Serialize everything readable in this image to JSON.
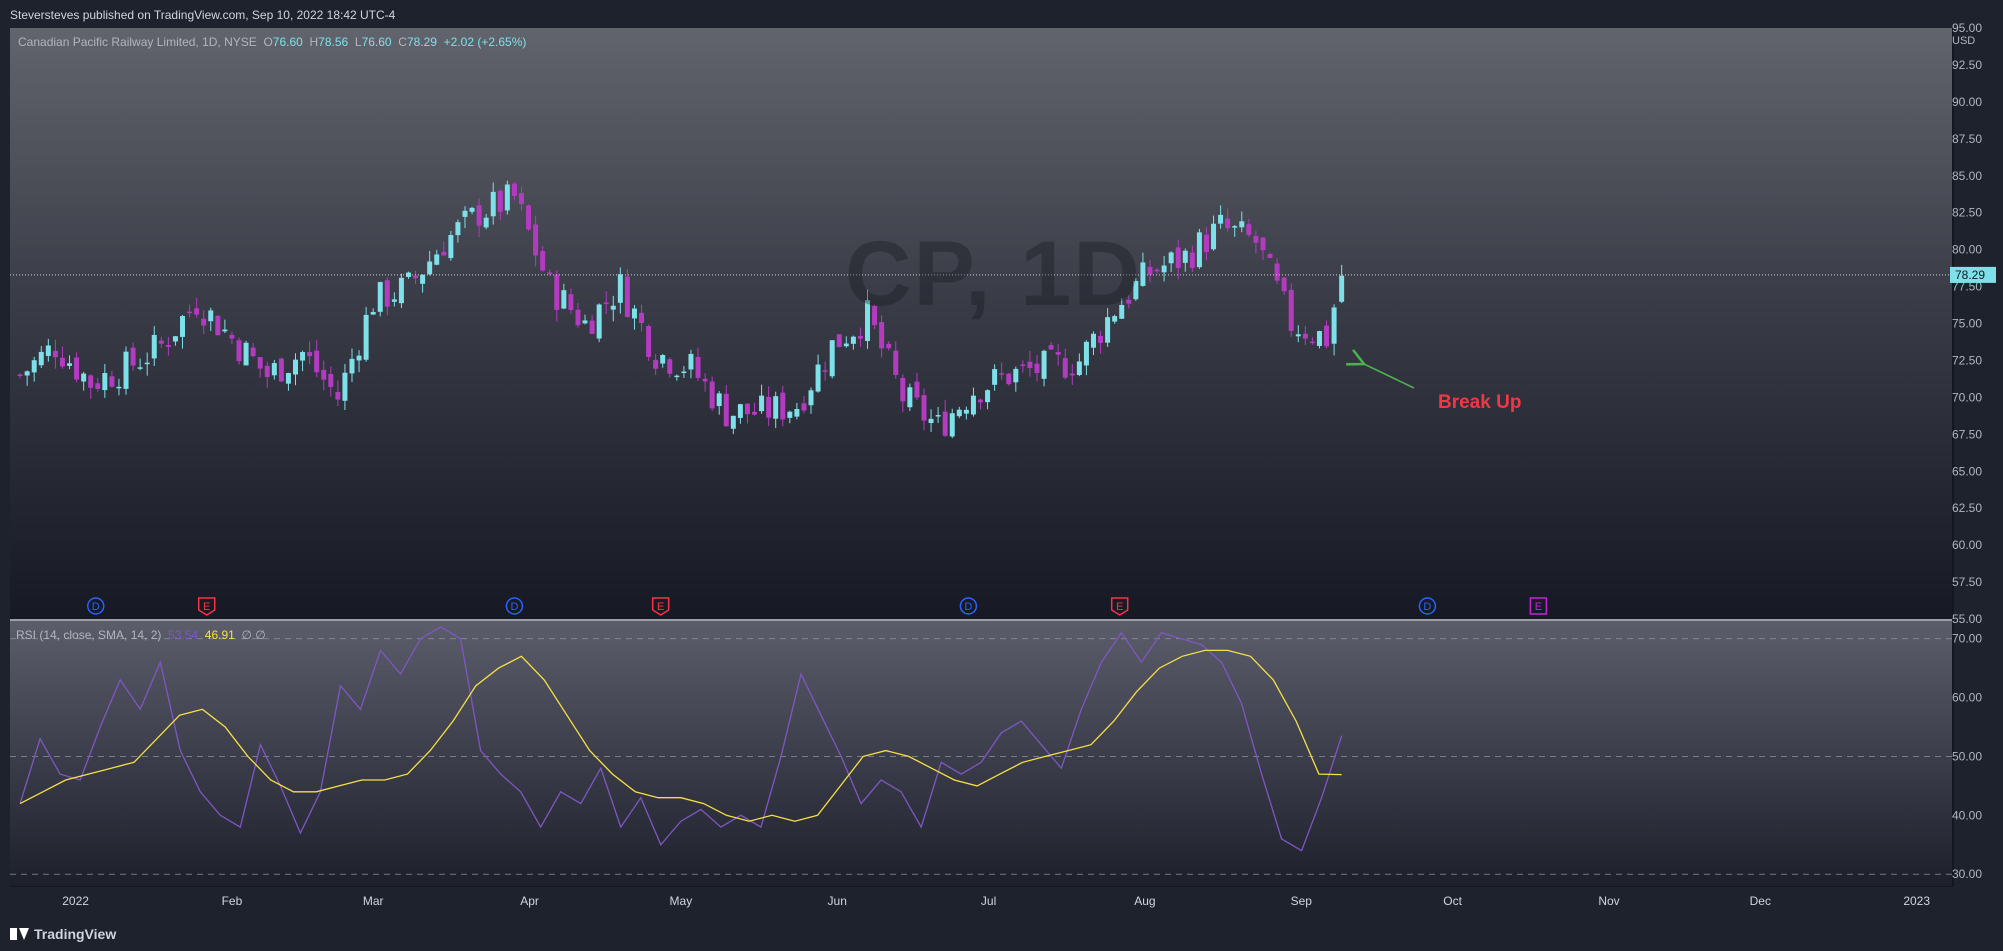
{
  "header": {
    "published": "Steversteves published on TradingView.com, Sep 10, 2022 18:42 UTC-4"
  },
  "legend": {
    "symbol": "Canadian Pacific Railway Limited, 1D, NYSE",
    "open_label": "O",
    "open": "76.60",
    "high_label": "H",
    "high": "78.56",
    "low_label": "L",
    "low": "76.60",
    "close_label": "C",
    "close": "78.29",
    "change": "+2.02 (+2.65%)"
  },
  "watermark": "CP, 1D",
  "annotation": "Break Up",
  "rsi_legend": {
    "label": "RSI (14, close, SMA, 14, 2)",
    "value_rsi": "53.54",
    "value_sma": "46.91",
    "extra": "∅ ∅"
  },
  "branding": "TradingView",
  "colors": {
    "up": "#7ee0e8",
    "down": "#b23bc0",
    "rsi_line": "#7e57c2",
    "rsi_sma": "#f6e043",
    "annotation": "#f23645",
    "arrow": "#4caf50"
  },
  "chart_data": [
    {
      "type": "candlestick",
      "currency": "USD",
      "ylim": [
        55.0,
        95.0
      ],
      "y_ticks": [
        "95.00",
        "92.50",
        "90.00",
        "87.50",
        "85.00",
        "82.50",
        "80.00",
        "77.50",
        "75.00",
        "72.50",
        "70.00",
        "67.50",
        "65.00",
        "62.50",
        "60.00",
        "57.50",
        "55.00"
      ],
      "last_price": 78.29,
      "last_price_label": "78.29",
      "x_ticks": [
        "2022",
        "Feb",
        "Mar",
        "Apr",
        "May",
        "Jun",
        "Jul",
        "Aug",
        "Sep",
        "Oct",
        "Nov",
        "Dec",
        "2023"
      ],
      "events": [
        {
          "date": "2022-01-05",
          "type": "D",
          "label": "D"
        },
        {
          "date": "2022-01-27",
          "type": "E",
          "label": "E"
        },
        {
          "date": "2022-03-29",
          "type": "D",
          "label": "D"
        },
        {
          "date": "2022-04-27",
          "type": "E",
          "label": "E"
        },
        {
          "date": "2022-06-27",
          "type": "D",
          "label": "D"
        },
        {
          "date": "2022-07-27",
          "type": "E",
          "label": "E"
        },
        {
          "date": "2022-09-26",
          "type": "D",
          "label": "D"
        },
        {
          "date": "2022-10-18",
          "type": "E-upcoming",
          "label": "E"
        }
      ],
      "closes": [
        {
          "date": "2021-12-21",
          "close": 71.5
        },
        {
          "date": "2021-12-28",
          "close": 73.5
        },
        {
          "date": "2022-01-04",
          "close": 71.0
        },
        {
          "date": "2022-01-11",
          "close": 72.0
        },
        {
          "date": "2022-01-18",
          "close": 73.5
        },
        {
          "date": "2022-01-25",
          "close": 76.5
        },
        {
          "date": "2022-02-01",
          "close": 74.0
        },
        {
          "date": "2022-02-08",
          "close": 71.5
        },
        {
          "date": "2022-02-15",
          "close": 73.0
        },
        {
          "date": "2022-02-22",
          "close": 70.0
        },
        {
          "date": "2022-03-01",
          "close": 76.5
        },
        {
          "date": "2022-03-08",
          "close": 77.5
        },
        {
          "date": "2022-03-15",
          "close": 80.5
        },
        {
          "date": "2022-03-22",
          "close": 82.5
        },
        {
          "date": "2022-03-29",
          "close": 83.5
        },
        {
          "date": "2022-04-05",
          "close": 77.5
        },
        {
          "date": "2022-04-12",
          "close": 75.0
        },
        {
          "date": "2022-04-19",
          "close": 77.5
        },
        {
          "date": "2022-04-26",
          "close": 73.0
        },
        {
          "date": "2022-05-03",
          "close": 72.0
        },
        {
          "date": "2022-05-10",
          "close": 69.0
        },
        {
          "date": "2022-05-17",
          "close": 69.0
        },
        {
          "date": "2022-05-24",
          "close": 69.5
        },
        {
          "date": "2022-05-31",
          "close": 73.5
        },
        {
          "date": "2022-06-07",
          "close": 75.5
        },
        {
          "date": "2022-06-14",
          "close": 70.0
        },
        {
          "date": "2022-06-21",
          "close": 68.0
        },
        {
          "date": "2022-06-28",
          "close": 70.5
        },
        {
          "date": "2022-07-05",
          "close": 71.5
        },
        {
          "date": "2022-07-12",
          "close": 72.0
        },
        {
          "date": "2022-07-19",
          "close": 72.5
        },
        {
          "date": "2022-07-26",
          "close": 76.0
        },
        {
          "date": "2022-08-02",
          "close": 78.5
        },
        {
          "date": "2022-08-09",
          "close": 79.5
        },
        {
          "date": "2022-08-16",
          "close": 81.5
        },
        {
          "date": "2022-08-23",
          "close": 80.5
        },
        {
          "date": "2022-08-30",
          "close": 75.0
        },
        {
          "date": "2022-09-06",
          "close": 74.0
        },
        {
          "date": "2022-09-09",
          "close": 78.29
        }
      ]
    },
    {
      "type": "line",
      "title": "RSI (14, close, SMA, 14, 2)",
      "ylim": [
        28,
        73
      ],
      "y_ticks": [
        "70.00",
        "60.00",
        "50.00",
        "40.00",
        "30.00"
      ],
      "reference_lines": [
        70,
        50,
        30
      ],
      "series": [
        {
          "name": "RSI",
          "values": [
            42,
            53,
            47,
            46,
            55,
            63,
            58,
            66,
            51,
            44,
            40,
            38,
            52,
            45,
            37,
            44,
            62,
            58,
            68,
            64,
            70,
            72,
            70,
            51,
            47,
            44,
            38,
            44,
            42,
            48,
            38,
            43,
            35,
            39,
            41,
            38,
            40,
            38,
            50,
            64,
            57,
            50,
            42,
            46,
            44,
            38,
            49,
            47,
            49,
            54,
            56,
            52,
            48,
            58,
            66,
            71,
            66,
            71,
            70,
            69,
            66,
            59,
            47,
            36,
            34,
            43,
            53.54
          ]
        },
        {
          "name": "RSI-based MA",
          "values": [
            42,
            44,
            46,
            47,
            48,
            49,
            53,
            57,
            58,
            55,
            50,
            46,
            44,
            44,
            45,
            46,
            46,
            47,
            51,
            56,
            62,
            65,
            67,
            63,
            57,
            51,
            47,
            44,
            43,
            43,
            42,
            40,
            39,
            40,
            39,
            40,
            45,
            50,
            51,
            50,
            48,
            46,
            45,
            47,
            49,
            50,
            51,
            52,
            56,
            61,
            65,
            67,
            68,
            68,
            67,
            63,
            56,
            47,
            46.91
          ]
        }
      ]
    }
  ]
}
